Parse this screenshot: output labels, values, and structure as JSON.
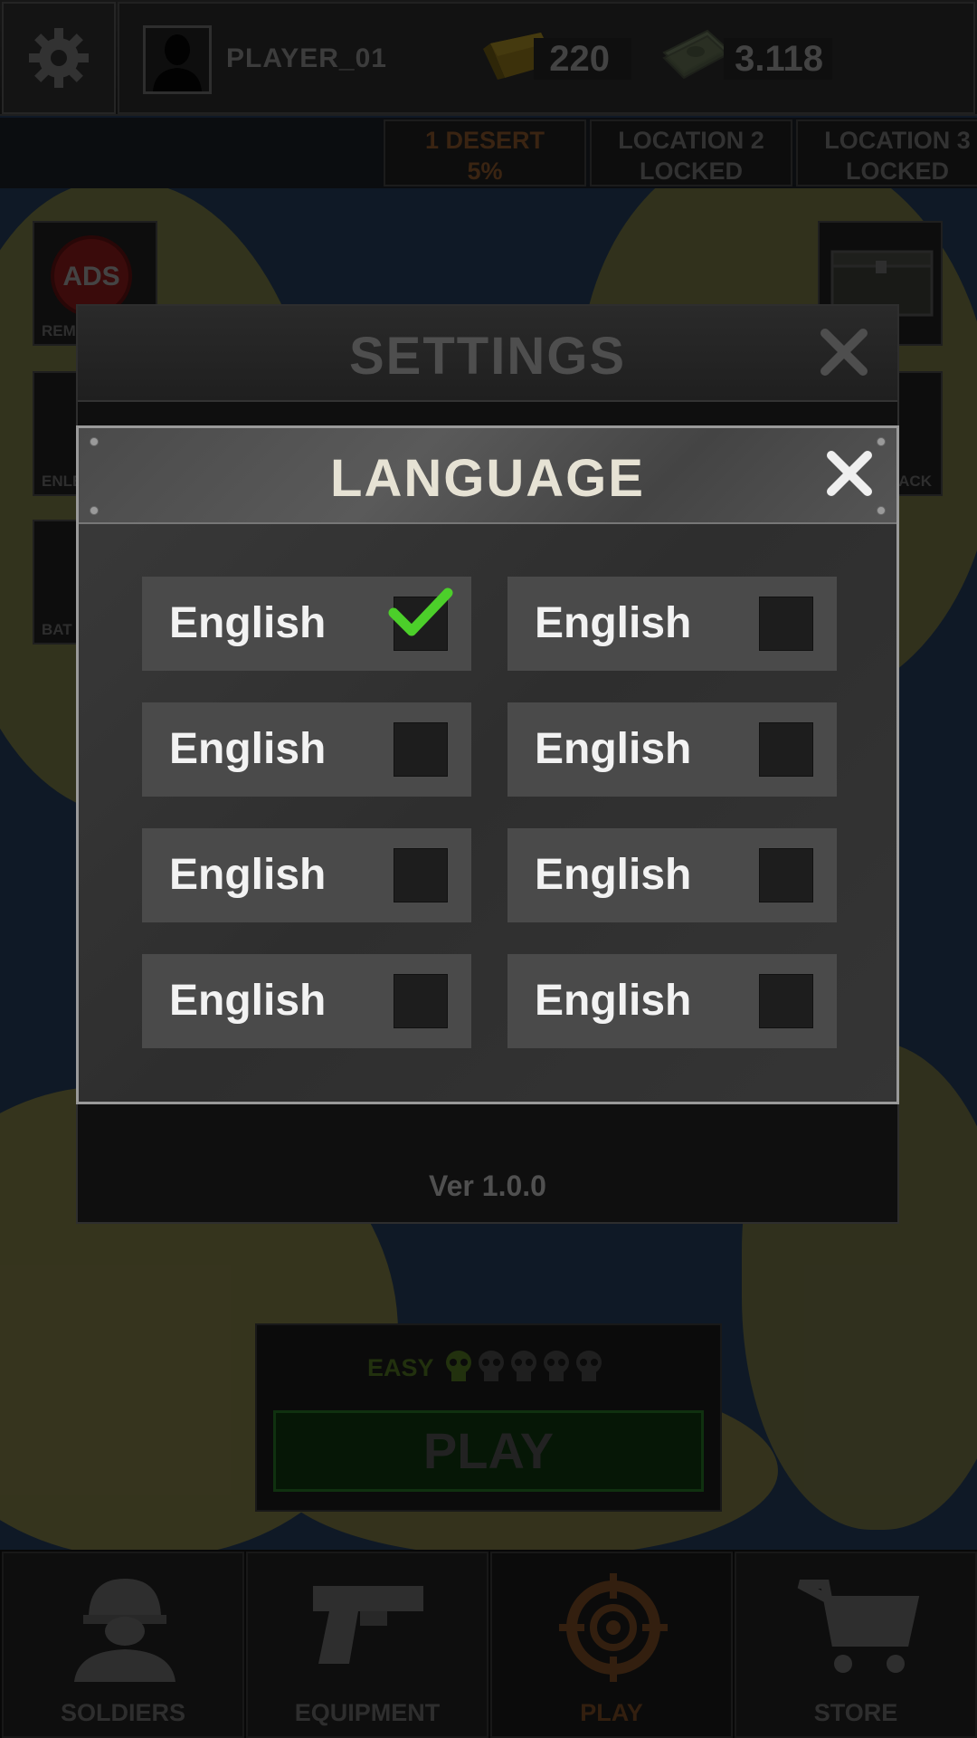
{
  "topbar": {
    "player_name": "PLAYER_01",
    "gold": "220",
    "cash": "3.118"
  },
  "locations": [
    {
      "line1": "1 DESERT",
      "line2": "5%"
    },
    {
      "line1": "LOCATION 2",
      "line2": "LOCKED"
    },
    {
      "line1": "LOCATION 3",
      "line2": "LOCKED"
    }
  ],
  "side_buttons": {
    "remove_ads_icon_text": "ADS",
    "remove_ads_label": "REM",
    "enlist_label": "ENLE",
    "battle_label": "BAT",
    "pack_label": "PACK"
  },
  "settings": {
    "title": "SETTINGS",
    "version": "Ver 1.0.0"
  },
  "language_dialog": {
    "title": "LANGUAGE",
    "options": [
      {
        "label": "English",
        "selected": true
      },
      {
        "label": "English",
        "selected": false
      },
      {
        "label": "English",
        "selected": false
      },
      {
        "label": "English",
        "selected": false
      },
      {
        "label": "English",
        "selected": false
      },
      {
        "label": "English",
        "selected": false
      },
      {
        "label": "English",
        "selected": false
      },
      {
        "label": "English",
        "selected": false
      }
    ]
  },
  "play_panel": {
    "difficulty": "EASY",
    "skull_level": 1,
    "skull_total": 5,
    "play_label": "PLAY"
  },
  "nav": {
    "soldiers": "SOLDIERS",
    "equipment": "EQUIPMENT",
    "play": "PLAY",
    "store": "STORE"
  },
  "colors": {
    "check_green": "#4ccf2a",
    "active_orange": "#6b4322",
    "play_green": "#0b2a0b"
  }
}
